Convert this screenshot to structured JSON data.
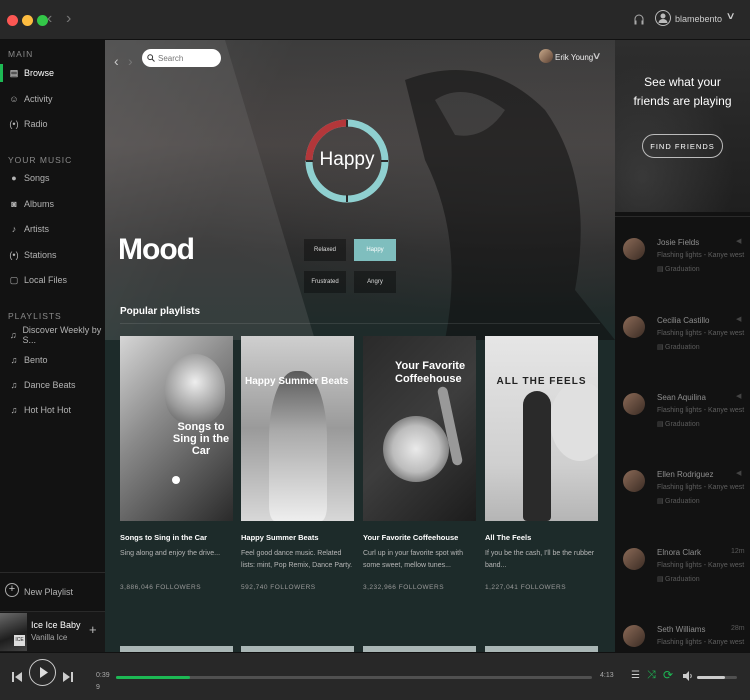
{
  "topbar": {
    "user": "blamebento"
  },
  "sidebar": {
    "main_heading": "MAIN",
    "main_items": [
      {
        "label": "Browse"
      },
      {
        "label": "Activity"
      },
      {
        "label": "Radio"
      }
    ],
    "music_heading": "YOUR MUSIC",
    "music_items": [
      {
        "label": "Songs"
      },
      {
        "label": "Albums"
      },
      {
        "label": "Artists"
      },
      {
        "label": "Stations"
      },
      {
        "label": "Local Files"
      }
    ],
    "playlists_heading": "PLAYLISTS",
    "playlists": [
      {
        "label": "Discover Weekly by S..."
      },
      {
        "label": "Bento"
      },
      {
        "label": "Dance Beats"
      },
      {
        "label": "Hot Hot Hot"
      }
    ],
    "new_playlist": "New Playlist",
    "now_playing": {
      "title": "Ice Ice Baby",
      "artist": "Vanilla Ice"
    }
  },
  "main": {
    "search_placeholder": "Search",
    "user_name": "Erik Young",
    "mood_wheel_label": "Happy",
    "page_title": "Mood",
    "moods": [
      "Relaxed",
      "Happy",
      "Frustrated",
      "Angry"
    ],
    "selected_mood": "Happy",
    "section_title": "Popular playlists",
    "cards": [
      {
        "art_text": "Songs to Sing in the Car",
        "title": "Songs to Sing in the Car",
        "desc": "Sing along and enjoy the drive...",
        "followers": "3,886,046 FOLLOWERS"
      },
      {
        "art_text": "Happy Summer Beats",
        "title": "Happy Summer Beats",
        "desc": "Feel good dance music. Related lists: mint, Pop Remix, Dance Party.",
        "followers": "592,740 FOLLOWERS"
      },
      {
        "art_text": "Your Favorite Coffeehouse",
        "title": "Your Favorite Coffeehouse",
        "desc": "Curl up in your favorite spot with some sweet, mellow tunes...",
        "followers": "3,232,966 FOLLOWERS"
      },
      {
        "art_text": "ALL THE FEELS",
        "title": "All The Feels",
        "desc": "If you be the cash, I'll be the rubber band...",
        "followers": "1,227,041 FOLLOWERS"
      }
    ]
  },
  "friends": {
    "prompt": "See what your friends are playing",
    "find_button": "FIND FRIENDS",
    "list": [
      {
        "name": "Josie Fields",
        "song": "Flashing lights - Kanye west",
        "source": "Graduation",
        "time": ""
      },
      {
        "name": "Cecilia Castillo",
        "song": "Flashing lights - Kanye west",
        "source": "Graduation",
        "time": ""
      },
      {
        "name": "Sean Aquilina",
        "song": "Flashing lights - Kanye west",
        "source": "Graduation",
        "time": ""
      },
      {
        "name": "Ellen Rodriguez",
        "song": "Flashing lights - Kanye west",
        "source": "Graduation",
        "time": ""
      },
      {
        "name": "Elnora Clark",
        "song": "Flashing lights - Kanye west",
        "source": "Graduation",
        "time": "12m"
      },
      {
        "name": "Seth Williams",
        "song": "Flashing lights - Kanye west",
        "source": "",
        "time": "28m"
      }
    ]
  },
  "player": {
    "elapsed": "0:39",
    "elapsed_extra": "9",
    "duration": "4:13",
    "progress": 0.155,
    "volume": 0.7
  },
  "colors": {
    "accent": "#1db954",
    "mood_ring": "#8fd0d0",
    "mood_ring_red": "#b3373a",
    "selected_chip": "#7fbebe"
  }
}
